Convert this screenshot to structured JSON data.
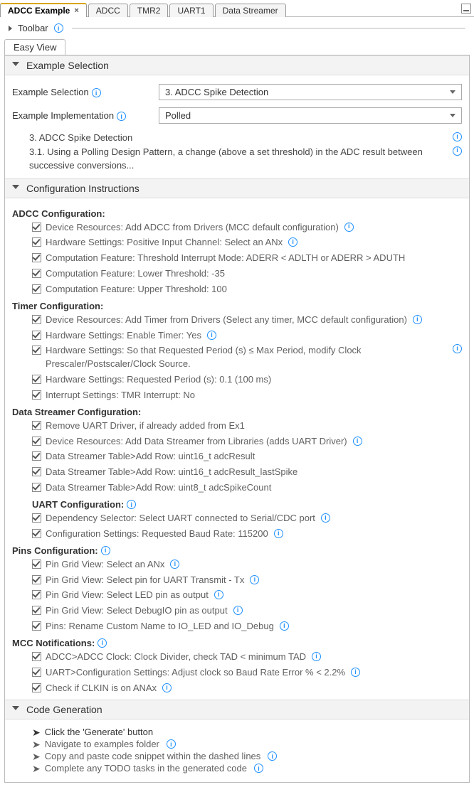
{
  "tabs": {
    "t0": "ADCC Example",
    "t1": "ADCC",
    "t2": "TMR2",
    "t3": "UART1",
    "t4": "Data Streamer"
  },
  "toolbar_label": "Toolbar",
  "subtab": "Easy View",
  "sections": {
    "example_selection": "Example Selection",
    "config_instr": "Configuration Instructions",
    "codegen": "Code Generation"
  },
  "example": {
    "selection_label": "Example Selection",
    "selection_value": "3. ADCC Spike Detection",
    "impl_label": "Example Implementation",
    "impl_value": "Polled",
    "desc_title": "3. ADCC Spike Detection",
    "desc_body": "3.1. Using a Polling Design Pattern, a change (above a set threshold) in the ADC result between successive conversions..."
  },
  "adcc": {
    "header": "ADCC Configuration:",
    "c0": "Device Resources: Add ADCC from Drivers (MCC default configuration)",
    "c1": "Hardware Settings: Positive Input Channel: Select an ANx",
    "c2": "Computation Feature: Threshold Interrupt Mode: ADERR < ADLTH or ADERR > ADUTH",
    "c3": "Computation Feature: Lower Threshold: -35",
    "c4": "Computation Feature: Upper Threshold: 100"
  },
  "timer": {
    "header": "Timer Configuration:",
    "c0": "Device Resources: Add Timer from Drivers (Select any timer, MCC default configuration)",
    "c1": "Hardware Settings: Enable Timer: Yes",
    "c2": "Hardware Settings: So that Requested Period (s) ≤ Max Period, modify Clock Prescaler/Postscaler/Clock Source.",
    "c3": "Hardware Settings: Requested Period (s): 0.1 (100 ms)",
    "c4": "Interrupt Settings: TMR Interrupt: No"
  },
  "ds": {
    "header": "Data Streamer Configuration:",
    "c0": "Remove UART Driver, if already added from Ex1",
    "c1": "Device Resources: Add Data Streamer from Libraries (adds UART Driver)",
    "c2": "Data Streamer Table>Add Row: uint16_t adcResult",
    "c3": "Data Streamer Table>Add Row: uint16_t adcResult_lastSpike",
    "c4": "Data Streamer Table>Add Row: uint8_t adcSpikeCount"
  },
  "uart": {
    "header": "UART Configuration:",
    "c0": "Dependency Selector: Select UART connected to Serial/CDC port",
    "c1": "Configuration Settings: Requested Baud Rate: 115200"
  },
  "pins": {
    "header": "Pins Configuration:",
    "c0": "Pin Grid View: Select an ANx",
    "c1": "Pin Grid View: Select pin for UART Transmit - Tx",
    "c2": "Pin Grid View: Select LED pin as output",
    "c3": "Pin Grid View: Select DebugIO pin as output",
    "c4": "Pins: Rename Custom Name to IO_LED and IO_Debug"
  },
  "mcc": {
    "header": "MCC Notifications:",
    "c0": "ADCC>ADCC Clock: Clock Divider, check TAD < minimum TAD",
    "c1": "UART>Configuration Settings: Adjust clock so Baud Rate Error % < 2.2%",
    "c2": "Check if CLKIN is on ANAx"
  },
  "codegen": {
    "c0": "Click the 'Generate' button",
    "c1": "Navigate to examples folder",
    "c2": "Copy and paste code snippet within the dashed lines",
    "c3": "Complete any TODO tasks in the generated code"
  }
}
